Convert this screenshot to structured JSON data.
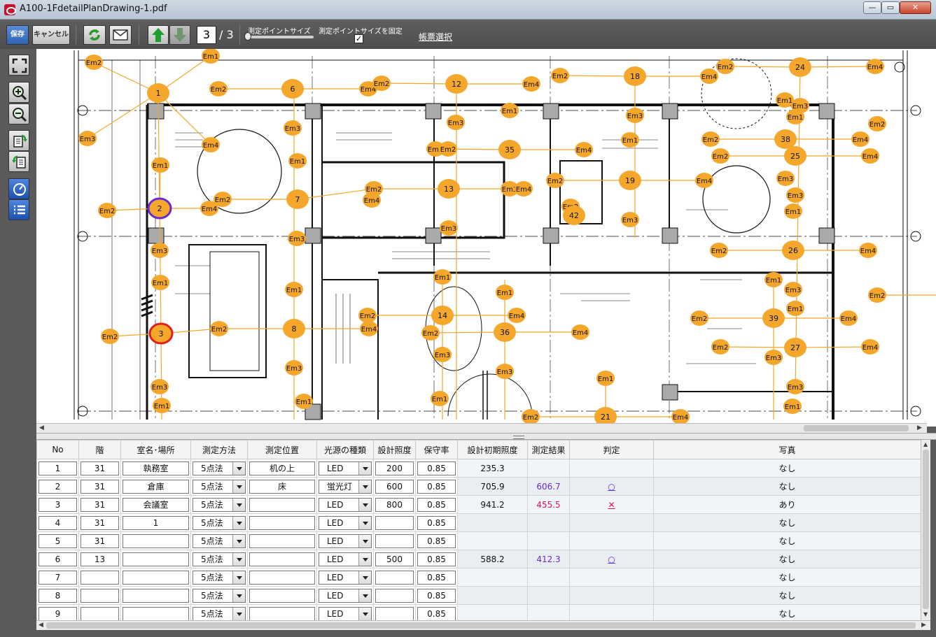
{
  "window": {
    "title": "A100-1FdetailPlanDrawing-1.pdf",
    "min": "—",
    "max": "▭",
    "close": "✕"
  },
  "toolbar": {
    "save_label": "保存",
    "cancel_label": "キャンセル",
    "page_current": "3",
    "page_total": "/ 3",
    "point_size_label": "測定ポイントサイズ",
    "point_size_fix_label": "測定ポイントサイズを固定",
    "point_size_fix_checked": "✓",
    "report_select_label": "帳票選択"
  },
  "drawing": {
    "points": [
      [
        "Em2",
        134,
        89,
        "s"
      ],
      [
        "Em1",
        301,
        80,
        "s"
      ],
      [
        "1",
        226,
        133,
        "b"
      ],
      [
        "Em2",
        312,
        127,
        "s"
      ],
      [
        "6",
        418,
        127,
        "b"
      ],
      [
        "Em4",
        526,
        127,
        "s"
      ],
      [
        "Em2",
        545,
        119,
        "s"
      ],
      [
        "12",
        652,
        120,
        "b"
      ],
      [
        "Em4",
        759,
        120,
        "s"
      ],
      [
        "Em2",
        800,
        108,
        "s"
      ],
      [
        "18",
        907,
        109,
        "b"
      ],
      [
        "Em4",
        1013,
        109,
        "s"
      ],
      [
        "Em2",
        1036,
        95,
        "s"
      ],
      [
        "24",
        1143,
        96,
        "b"
      ],
      [
        "Em4",
        1250,
        95,
        "s"
      ],
      [
        "Em3",
        125,
        198,
        "s"
      ],
      [
        "Em4",
        301,
        207,
        "s"
      ],
      [
        "Em3",
        418,
        183,
        "s"
      ],
      [
        "Em1",
        728,
        158,
        "s"
      ],
      [
        "Em3",
        651,
        175,
        "s"
      ],
      [
        "Em3",
        907,
        165,
        "s"
      ],
      [
        "Em1",
        1121,
        143,
        "s"
      ],
      [
        "Em3",
        1143,
        151,
        "s"
      ],
      [
        "Em1",
        1136,
        167,
        "s"
      ],
      [
        "Em2",
        1253,
        177,
        "s"
      ],
      [
        "Em1",
        229,
        236,
        "s"
      ],
      [
        "Em1",
        425,
        230,
        "s"
      ],
      [
        "Em2",
        622,
        213,
        "s"
      ],
      [
        "Em2",
        640,
        213,
        "s"
      ],
      [
        "35",
        728,
        214,
        "b"
      ],
      [
        "Em4",
        834,
        214,
        "s"
      ],
      [
        "Em1",
        900,
        200,
        "s"
      ],
      [
        "Em2",
        1015,
        199,
        "s"
      ],
      [
        "38",
        1122,
        199,
        "b"
      ],
      [
        "Em4",
        1229,
        199,
        "s"
      ],
      [
        "Em2",
        1029,
        223,
        "s"
      ],
      [
        "25",
        1136,
        223,
        "b"
      ],
      [
        "Em4",
        1243,
        223,
        "s"
      ],
      [
        "Em2",
        153,
        301,
        "s"
      ],
      [
        "2",
        228,
        298,
        "p"
      ],
      [
        "Em4",
        299,
        298,
        "s"
      ],
      [
        "Em2",
        318,
        285,
        "s"
      ],
      [
        "7",
        425,
        285,
        "b"
      ],
      [
        "Em2",
        534,
        270,
        "s"
      ],
      [
        "Em4",
        531,
        286,
        "s"
      ],
      [
        "13",
        641,
        270,
        "b"
      ],
      [
        "Em3",
        728,
        270,
        "s"
      ],
      [
        "Em4",
        748,
        270,
        "s"
      ],
      [
        "Em2",
        793,
        258,
        "s"
      ],
      [
        "19",
        900,
        258,
        "b"
      ],
      [
        "Em4",
        1006,
        258,
        "s"
      ],
      [
        "Em3",
        1122,
        255,
        "s"
      ],
      [
        "Em3",
        1136,
        279,
        "s"
      ],
      [
        "Em2",
        815,
        295,
        "s"
      ],
      [
        "42",
        820,
        308,
        "b"
      ],
      [
        "Em3",
        900,
        314,
        "s"
      ],
      [
        "Em1",
        1133,
        302,
        "s"
      ],
      [
        "Em3",
        424,
        341,
        "s"
      ],
      [
        "Em3",
        641,
        326,
        "s"
      ],
      [
        "Em3",
        228,
        358,
        "s"
      ],
      [
        "Em2",
        1027,
        358,
        "s"
      ],
      [
        "26",
        1133,
        358,
        "b"
      ],
      [
        "Em4",
        1240,
        358,
        "s"
      ],
      [
        "Em1",
        229,
        404,
        "s"
      ],
      [
        "Em1",
        420,
        414,
        "s"
      ],
      [
        "Em1",
        632,
        396,
        "s"
      ],
      [
        "Em1",
        721,
        418,
        "s"
      ],
      [
        "Em1",
        1105,
        400,
        "s"
      ],
      [
        "Em3",
        1133,
        414,
        "s"
      ],
      [
        "Em2",
        1253,
        422,
        "s"
      ],
      [
        "Em1",
        1136,
        441,
        "s"
      ],
      [
        "Em2",
        157,
        481,
        "s"
      ],
      [
        "3",
        230,
        477,
        "r"
      ],
      [
        "Em2",
        313,
        470,
        "s"
      ],
      [
        "8",
        420,
        470,
        "b"
      ],
      [
        "Em2",
        525,
        451,
        "s"
      ],
      [
        "Em4",
        527,
        470,
        "s"
      ],
      [
        "14",
        632,
        451,
        "b"
      ],
      [
        "Em4",
        738,
        451,
        "s"
      ],
      [
        "Em2",
        615,
        476,
        "s"
      ],
      [
        "36",
        721,
        475,
        "b"
      ],
      [
        "Em4",
        829,
        475,
        "s"
      ],
      [
        "Em2",
        999,
        455,
        "s"
      ],
      [
        "39",
        1105,
        455,
        "b"
      ],
      [
        "Em4",
        1212,
        455,
        "s"
      ],
      [
        "Em2",
        1029,
        496,
        "s"
      ],
      [
        "27",
        1136,
        497,
        "b"
      ],
      [
        "Em4",
        1243,
        496,
        "s"
      ],
      [
        "Em3",
        420,
        526,
        "s"
      ],
      [
        "Em3",
        632,
        507,
        "s"
      ],
      [
        "Em3",
        721,
        531,
        "s"
      ],
      [
        "Em3",
        1105,
        511,
        "s"
      ],
      [
        "Em1",
        865,
        541,
        "s"
      ],
      [
        "Em3",
        228,
        553,
        "s"
      ],
      [
        "Em3",
        1136,
        553,
        "s"
      ],
      [
        "Em1",
        231,
        580,
        "s"
      ],
      [
        "Em1",
        434,
        574,
        "s"
      ],
      [
        "Em1",
        628,
        570,
        "s"
      ],
      [
        "Em1",
        1132,
        581,
        "s"
      ],
      [
        "Em2",
        758,
        596,
        "s"
      ],
      [
        "21",
        865,
        596,
        "b"
      ],
      [
        "Em4",
        972,
        596,
        "s"
      ]
    ],
    "lines": [
      [
        134,
        89,
        226,
        133
      ],
      [
        301,
        80,
        226,
        133
      ],
      [
        125,
        198,
        226,
        133
      ],
      [
        301,
        207,
        226,
        133
      ],
      [
        312,
        127,
        418,
        127
      ],
      [
        418,
        127,
        526,
        127
      ],
      [
        545,
        119,
        652,
        120
      ],
      [
        652,
        120,
        759,
        120
      ],
      [
        800,
        108,
        907,
        109
      ],
      [
        907,
        109,
        1013,
        109
      ],
      [
        1036,
        95,
        1143,
        96
      ],
      [
        1143,
        96,
        1250,
        95
      ],
      [
        226,
        133,
        228,
        298
      ],
      [
        229,
        236,
        228,
        298
      ],
      [
        153,
        301,
        228,
        298
      ],
      [
        228,
        298,
        299,
        298
      ],
      [
        318,
        285,
        425,
        285
      ],
      [
        425,
        285,
        534,
        270
      ],
      [
        534,
        270,
        641,
        270
      ],
      [
        641,
        270,
        748,
        270
      ],
      [
        793,
        258,
        900,
        258
      ],
      [
        900,
        258,
        1006,
        258
      ],
      [
        622,
        213,
        728,
        214
      ],
      [
        728,
        214,
        834,
        214
      ],
      [
        1015,
        199,
        1122,
        199
      ],
      [
        1122,
        199,
        1229,
        199
      ],
      [
        1029,
        223,
        1136,
        223
      ],
      [
        1136,
        223,
        1243,
        223
      ],
      [
        1143,
        96,
        1136,
        558
      ],
      [
        1027,
        358,
        1133,
        358
      ],
      [
        1133,
        358,
        1240,
        358
      ],
      [
        228,
        298,
        230,
        477
      ],
      [
        157,
        481,
        230,
        477
      ],
      [
        230,
        477,
        313,
        470
      ],
      [
        313,
        470,
        420,
        470
      ],
      [
        420,
        470,
        527,
        470
      ],
      [
        525,
        451,
        632,
        451
      ],
      [
        632,
        451,
        738,
        451
      ],
      [
        615,
        476,
        721,
        475
      ],
      [
        721,
        475,
        829,
        475
      ],
      [
        999,
        455,
        1105,
        455
      ],
      [
        1105,
        455,
        1212,
        455
      ],
      [
        1029,
        496,
        1136,
        497
      ],
      [
        1136,
        497,
        1243,
        496
      ],
      [
        230,
        477,
        231,
        600
      ],
      [
        420,
        127,
        420,
        600
      ],
      [
        652,
        120,
        652,
        600
      ],
      [
        907,
        109,
        907,
        340
      ],
      [
        721,
        400,
        721,
        600
      ],
      [
        632,
        396,
        632,
        600
      ],
      [
        1105,
        400,
        1105,
        600
      ],
      [
        758,
        596,
        865,
        596
      ],
      [
        865,
        596,
        972,
        596
      ],
      [
        865,
        541,
        865,
        596
      ],
      [
        1243,
        422,
        1337,
        422
      ]
    ]
  },
  "table": {
    "headers": [
      "No",
      "階",
      "室名･場所",
      "測定方法",
      "測定位置",
      "光源の種類",
      "設計照度",
      "保守率",
      "設計初期照度",
      "測定結果",
      "判定",
      "写真"
    ],
    "rows": [
      {
        "no": "1",
        "floor": "31",
        "room": "執務室",
        "method": "5点法",
        "position": "机の上",
        "light": "LED",
        "design": "200",
        "maint": "0.85",
        "initial": "235.3",
        "result": "",
        "judge": "",
        "photo": "なし"
      },
      {
        "no": "2",
        "floor": "31",
        "room": "倉庫",
        "method": "5点法",
        "position": "床",
        "light": "蛍光灯",
        "design": "600",
        "maint": "0.85",
        "initial": "705.9",
        "result": "606.7",
        "judge": "○",
        "photo": "なし"
      },
      {
        "no": "3",
        "floor": "31",
        "room": "会議室",
        "method": "5点法",
        "position": "",
        "light": "LED",
        "design": "800",
        "maint": "0.85",
        "initial": "941.2",
        "result": "455.5",
        "judge": "✕",
        "photo": "あり"
      },
      {
        "no": "4",
        "floor": "31",
        "room": "1",
        "method": "5点法",
        "position": "",
        "light": "LED",
        "design": "",
        "maint": "0.85",
        "initial": "",
        "result": "",
        "judge": "",
        "photo": "なし"
      },
      {
        "no": "5",
        "floor": "31",
        "room": "",
        "method": "5点法",
        "position": "",
        "light": "LED",
        "design": "",
        "maint": "0.85",
        "initial": "",
        "result": "",
        "judge": "",
        "photo": "なし"
      },
      {
        "no": "6",
        "floor": "13",
        "room": "",
        "method": "5点法",
        "position": "",
        "light": "LED",
        "design": "500",
        "maint": "0.85",
        "initial": "588.2",
        "result": "412.3",
        "judge": "○",
        "photo": "なし"
      },
      {
        "no": "7",
        "floor": "",
        "room": "",
        "method": "5点法",
        "position": "",
        "light": "LED",
        "design": "",
        "maint": "0.85",
        "initial": "",
        "result": "",
        "judge": "",
        "photo": "なし"
      },
      {
        "no": "8",
        "floor": "",
        "room": "",
        "method": "5点法",
        "position": "",
        "light": "LED",
        "design": "",
        "maint": "0.85",
        "initial": "",
        "result": "",
        "judge": "",
        "photo": "なし"
      },
      {
        "no": "9",
        "floor": "",
        "room": "",
        "method": "5点法",
        "position": "",
        "light": "LED",
        "design": "",
        "maint": "0.85",
        "initial": "",
        "result": "",
        "judge": "",
        "photo": "なし"
      }
    ]
  },
  "colors": {
    "marker": "#f4a72a",
    "marker_selected_purple": "#6a2bd1",
    "marker_selected_red": "#e02020",
    "ok": "#6a2bd1",
    "ng": "#e0114f"
  }
}
